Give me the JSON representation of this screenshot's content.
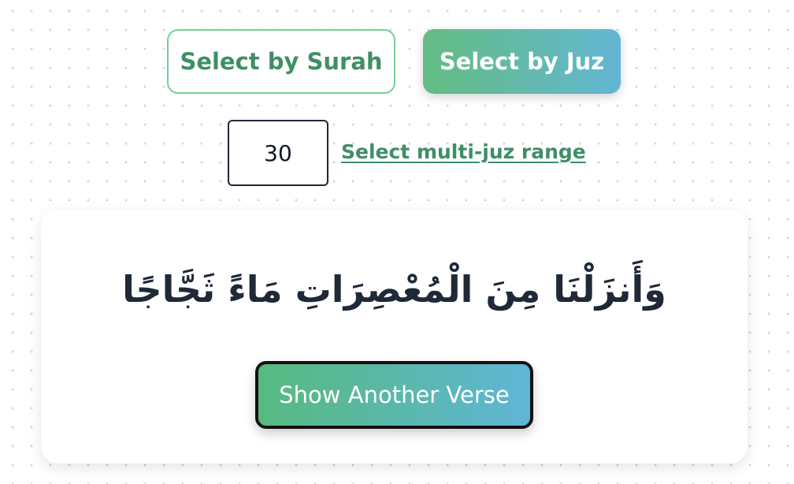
{
  "mode_selector": {
    "surah_label": "Select by Surah",
    "juz_label": "Select by Juz",
    "active": "juz"
  },
  "juz_picker": {
    "value": "30",
    "range_link_label": "Select multi-juz range"
  },
  "verse_card": {
    "verse_text": "وَأَنزَلْنَا مِنَ الْمُعْصِرَاتِ مَاءً ثَجَّاجًا",
    "show_another_label": "Show Another Verse"
  },
  "colors": {
    "accent_green": "#3f8f66",
    "gradient_start": "#63bd82",
    "gradient_end": "#63b6d3"
  }
}
